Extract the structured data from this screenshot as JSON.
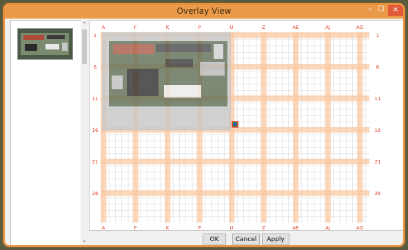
{
  "window": {
    "title": "Overlay View",
    "min_glyph": "–",
    "max_glyph": "□",
    "close_glyph": "×"
  },
  "colors": {
    "accent": "#e8913a",
    "grid_band": "#f9c9a4",
    "grid_line": "#b4b4b4",
    "label": "#e03a2a"
  },
  "grid": {
    "col_labels": [
      "A",
      "F",
      "K",
      "P",
      "U",
      "Z",
      "AE",
      "AJ",
      "AO"
    ],
    "row_labels": [
      "1",
      "6",
      "11",
      "16",
      "21",
      "26"
    ]
  },
  "buttons": {
    "ok": "OK",
    "cancel": "Cancel",
    "apply": "Apply"
  },
  "scrollbar": {
    "up": "⌃",
    "down": "⌄"
  }
}
